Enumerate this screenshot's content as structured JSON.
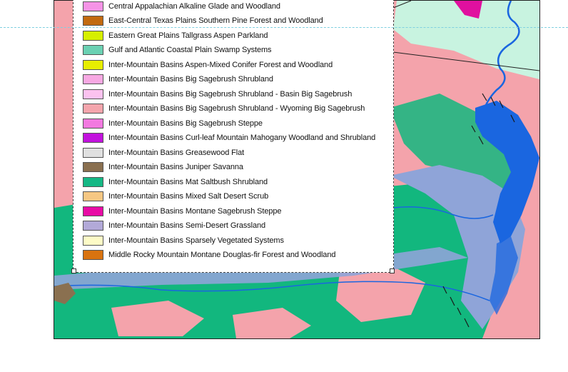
{
  "legend": {
    "items": [
      {
        "label": "Central Appalachian Alkaline Glade and Woodland",
        "color": "#f593e6"
      },
      {
        "label": "East-Central Texas Plains Southern Pine Forest and Woodland",
        "color": "#c26a10"
      },
      {
        "label": "Eastern Great Plains Tallgrass Aspen Parkland",
        "color": "#d6ef00"
      },
      {
        "label": "Gulf and Atlantic Coastal Plain Swamp Systems",
        "color": "#6bd1b3"
      },
      {
        "label": "Inter-Mountain Basins Aspen-Mixed Conifer Forest and Woodland",
        "color": "#e7ee00"
      },
      {
        "label": "Inter-Mountain Basins Big Sagebrush Shrubland",
        "color": "#f7a8e3"
      },
      {
        "label": "Inter-Mountain Basins Big Sagebrush Shrubland - Basin Big Sagebrush",
        "color": "#fbc2ef"
      },
      {
        "label": "Inter-Mountain Basins Big Sagebrush Shrubland - Wyoming Big Sagebrush",
        "color": "#f4a5ac"
      },
      {
        "label": "Inter-Mountain Basins Big Sagebrush Steppe",
        "color": "#f279e0"
      },
      {
        "label": "Inter-Mountain Basins Curl-leaf Mountain Mahogany Woodland and Shrubland",
        "color": "#c212dd"
      },
      {
        "label": "Inter-Mountain Basins Greasewood Flat",
        "color": "#e0e0e0"
      },
      {
        "label": "Inter-Mountain Basins Juniper Savanna",
        "color": "#8a7050"
      },
      {
        "label": "Inter-Mountain Basins Mat Saltbush Shrubland",
        "color": "#16b885"
      },
      {
        "label": "Inter-Mountain Basins Mixed Salt Desert Scrub",
        "color": "#f6c783"
      },
      {
        "label": "Inter-Mountain Basins Montane Sagebrush Steppe",
        "color": "#e80ba5"
      },
      {
        "label": "Inter-Mountain Basins Semi-Desert Grassland",
        "color": "#b2a9d8"
      },
      {
        "label": "Inter-Mountain Basins Sparsely Vegetated Systems",
        "color": "#fdfbc6"
      },
      {
        "label": "Middle Rocky Mountain Montane Douglas-fir Forest and Woodland",
        "color": "#d9730f"
      }
    ]
  },
  "map": {
    "colors": {
      "pink_shrubland": "#f4a3ab",
      "green_saltbush": "#12b77e",
      "water": "#1a66e0",
      "mint": "#c8f3e0",
      "magenta": "#e0109f",
      "semidesert": "#8fa4d8"
    }
  }
}
